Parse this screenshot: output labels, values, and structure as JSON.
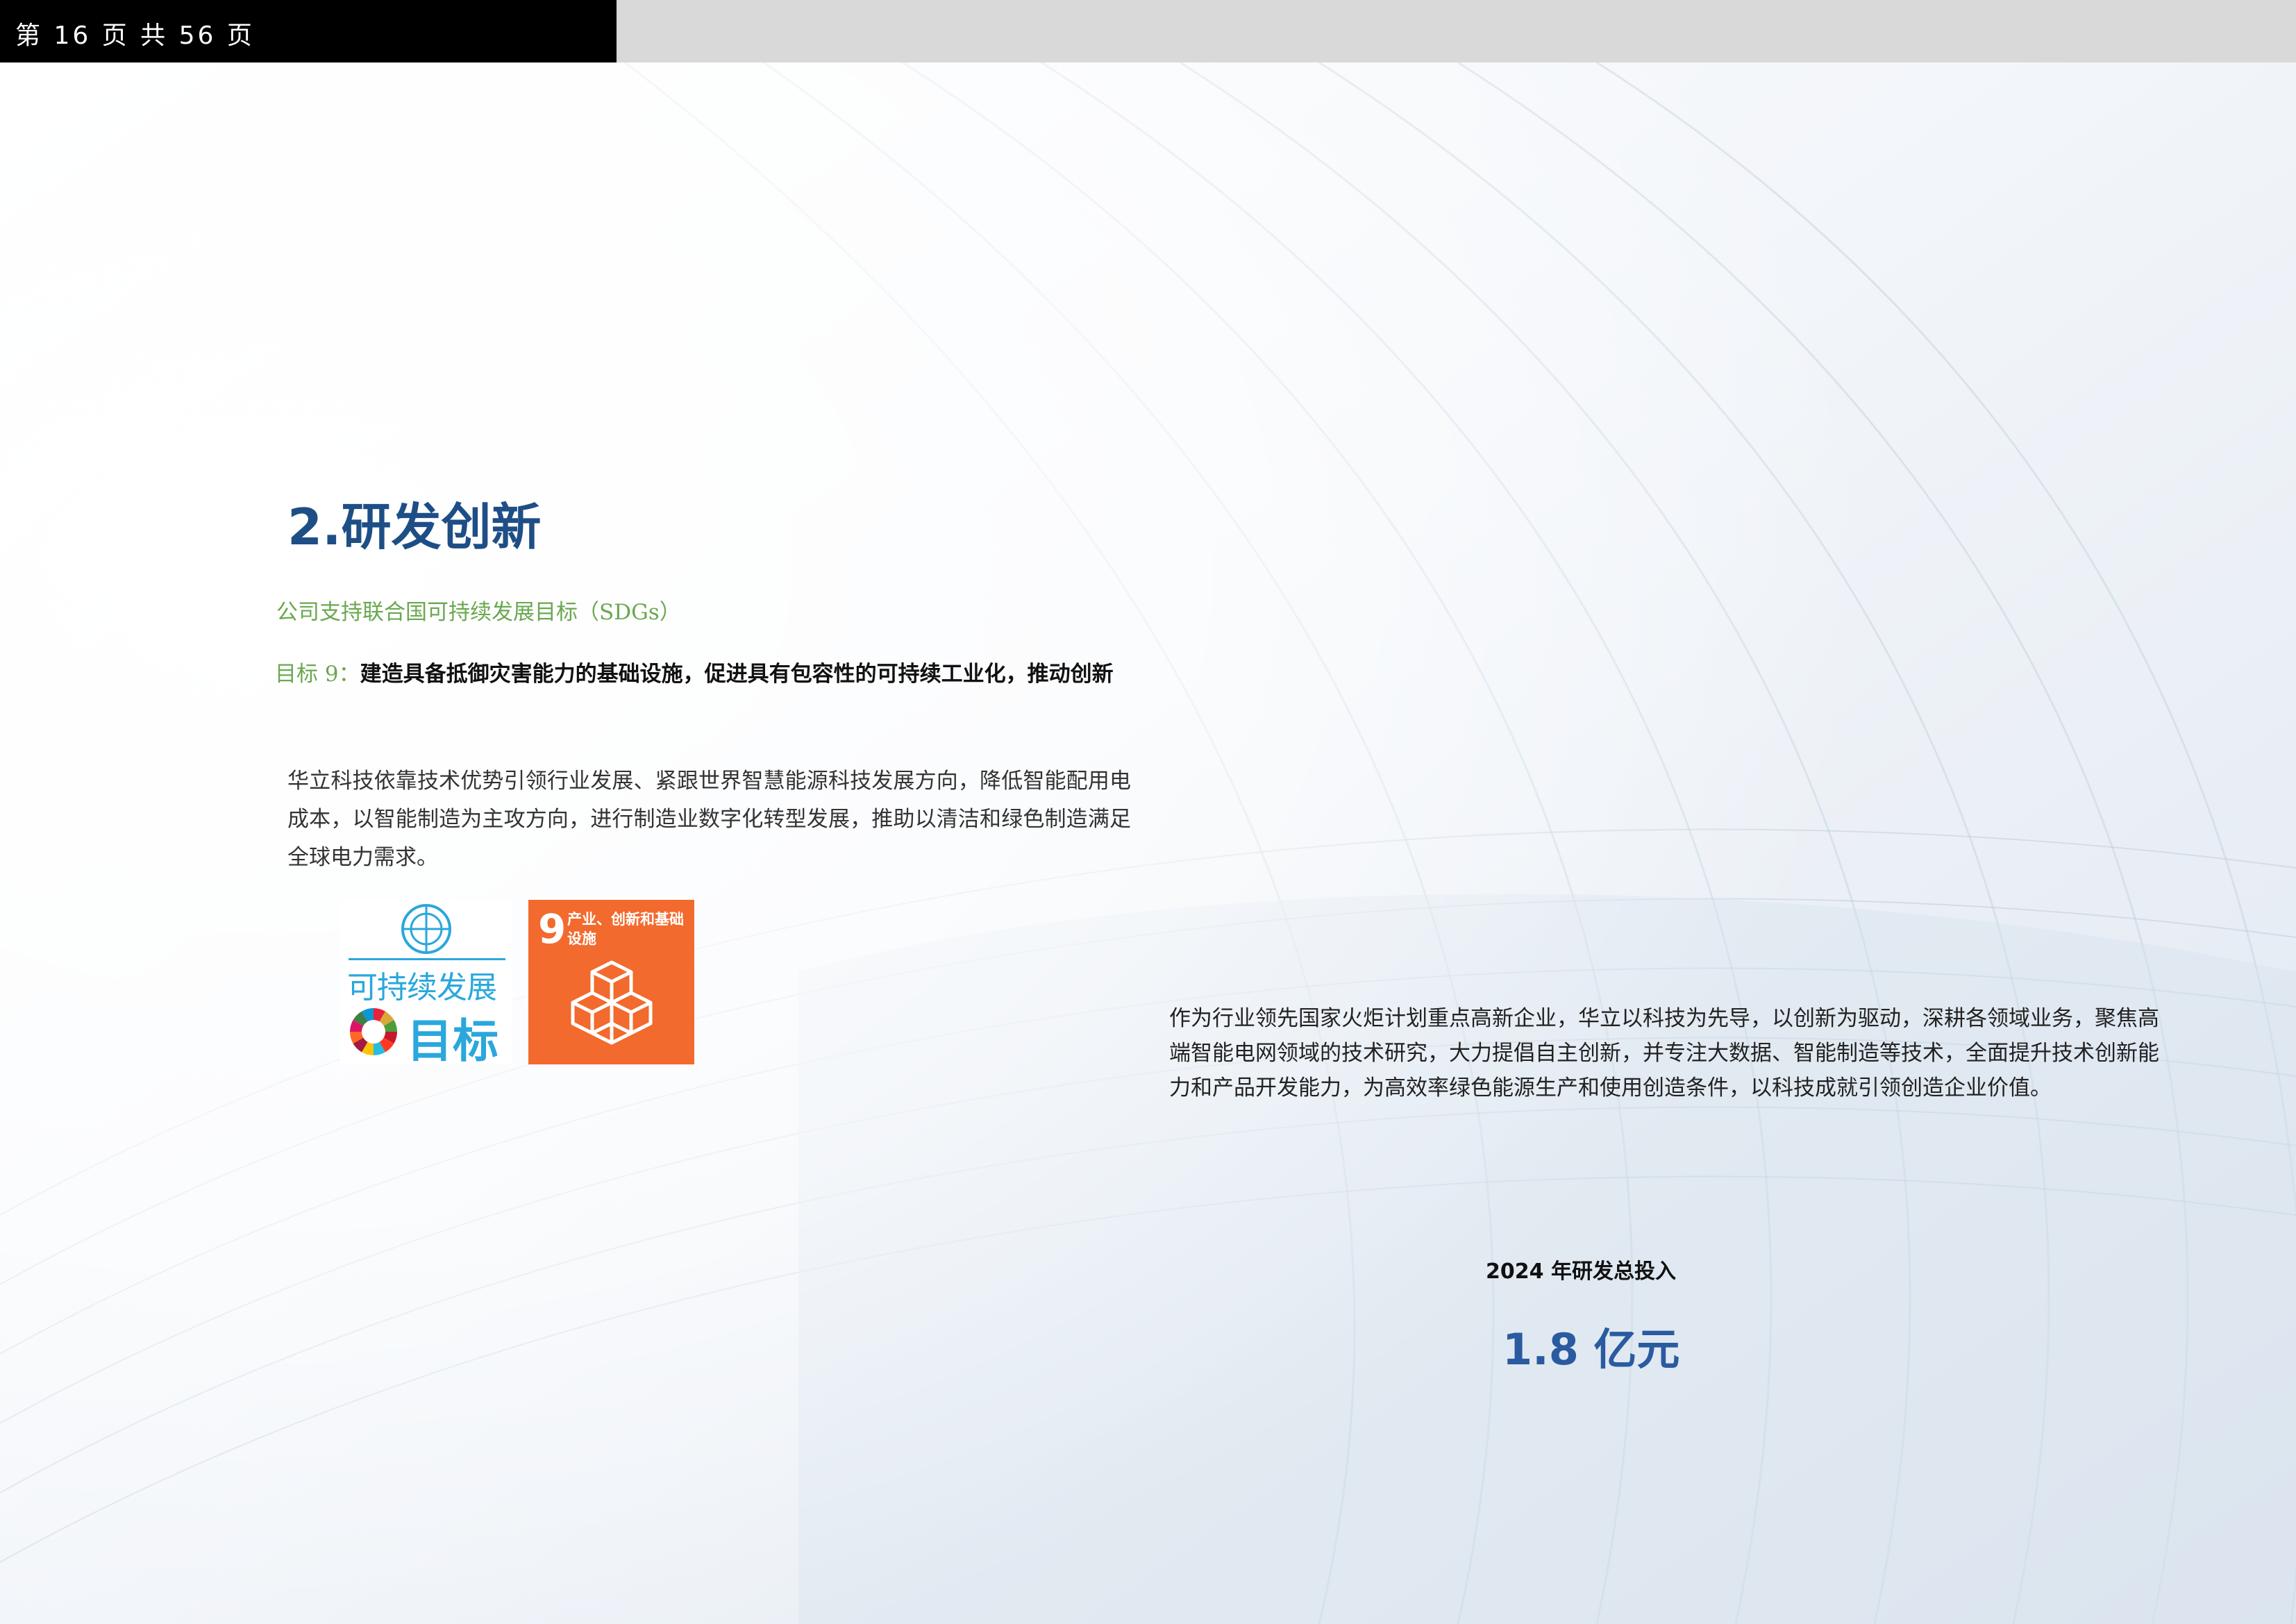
{
  "header": {
    "page_indicator": "第 16 页 共 56 页"
  },
  "section": {
    "title": "2.研发创新",
    "sdg_support": "公司支持联合国可持续发展目标（SDGs）",
    "goal_label": "目标 9：",
    "goal_text": "建造具备抵御灾害能力的基础设施，促进具有包容性的可持续工业化，推动创新",
    "intro_paragraph": "华立科技依靠技术优势引领行业发展、紧跟世界智慧能源科技发展方向，降低智能配用电成本，以智能制造为主攻方向，进行制造业数字化转型发展，推助以清洁和绿色制造满足全球电力需求。"
  },
  "sdg_logo": {
    "line1": "可持续发展",
    "line2": "目标",
    "icon": "un-emblem-icon"
  },
  "sdg9_tile": {
    "number": "9",
    "label": "产业、创新和基础设施",
    "icon": "cubes-icon",
    "color": "#f26a2d"
  },
  "body": {
    "paragraph": "作为行业领先国家火炬计划重点高新企业，华立以科技为先导，以创新为驱动，深耕各领域业务，聚焦高端智能电网领域的技术研究，大力提倡自主创新，并专注大数据、智能制造等技术，全面提升技术创新能力和产品开发能力，为高效率绿色能源生产和使用创造条件，以科技成就引领创造企业价值。"
  },
  "stat": {
    "label": "2024 年研发总投入",
    "value": "1.8 亿元"
  },
  "colors": {
    "title_blue": "#1e4e86",
    "accent_green": "#6aa84f",
    "stat_blue": "#2a5ba0",
    "sdg_blue": "#2aa7dc"
  }
}
